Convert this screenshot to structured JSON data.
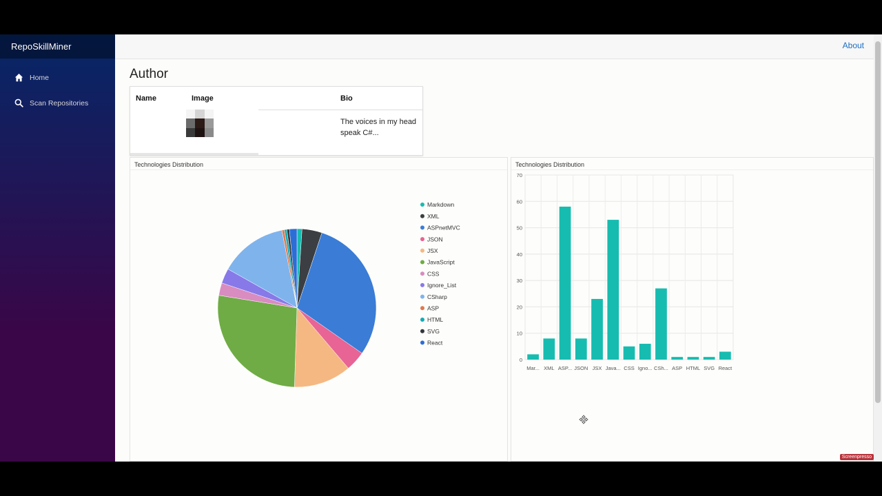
{
  "app": {
    "brand": "RepoSkillMiner"
  },
  "nav": [
    {
      "label": "Home",
      "icon": "home-icon"
    },
    {
      "label": "Scan Repositories",
      "icon": "search-icon"
    }
  ],
  "topbar": {
    "about_label": "About"
  },
  "page": {
    "title": "Author"
  },
  "author_table": {
    "headers": {
      "name": "Name",
      "image": "Image",
      "bio": "Bio"
    },
    "row": {
      "name": "",
      "bio": "The voices in my head speak C#..."
    }
  },
  "colors": {
    "accent": "#1b6ec2",
    "bar": "#17bcb0"
  },
  "chart_data": [
    {
      "type": "pie",
      "title": "Technologies Distribution",
      "legend_placement": "right",
      "categories": [
        "Markdown",
        "XML",
        "ASPnetMVC",
        "JSON",
        "JSX",
        "JavaScript",
        "CSS",
        "Ignore_List",
        "CSharp",
        "ASP",
        "HTML",
        "SVG",
        "React"
      ],
      "values": [
        2,
        8,
        58,
        8,
        23,
        53,
        5,
        6,
        27,
        1,
        1,
        1,
        3
      ],
      "colors": [
        "#17bcb0",
        "#3b3e42",
        "#3a7cd6",
        "#e76494",
        "#f5b882",
        "#6fac45",
        "#d98cc0",
        "#8779e8",
        "#7fb3ec",
        "#e0784f",
        "#14aab3",
        "#33373d",
        "#2b6ed6"
      ]
    },
    {
      "type": "bar",
      "title": "Technologies Distribution",
      "categories": [
        "Mar...",
        "XML",
        "ASP...",
        "JSON",
        "JSX",
        "Java...",
        "CSS",
        "Igno...",
        "CSh...",
        "ASP",
        "HTML",
        "SVG",
        "React"
      ],
      "values": [
        2,
        8,
        58,
        8,
        23,
        53,
        5,
        6,
        27,
        1,
        1,
        1,
        3
      ],
      "ylim": [
        0,
        70
      ],
      "yticks": [
        0,
        10,
        20,
        30,
        40,
        50,
        60,
        70
      ],
      "grid": true
    }
  ],
  "watermark": "Screenpresso"
}
